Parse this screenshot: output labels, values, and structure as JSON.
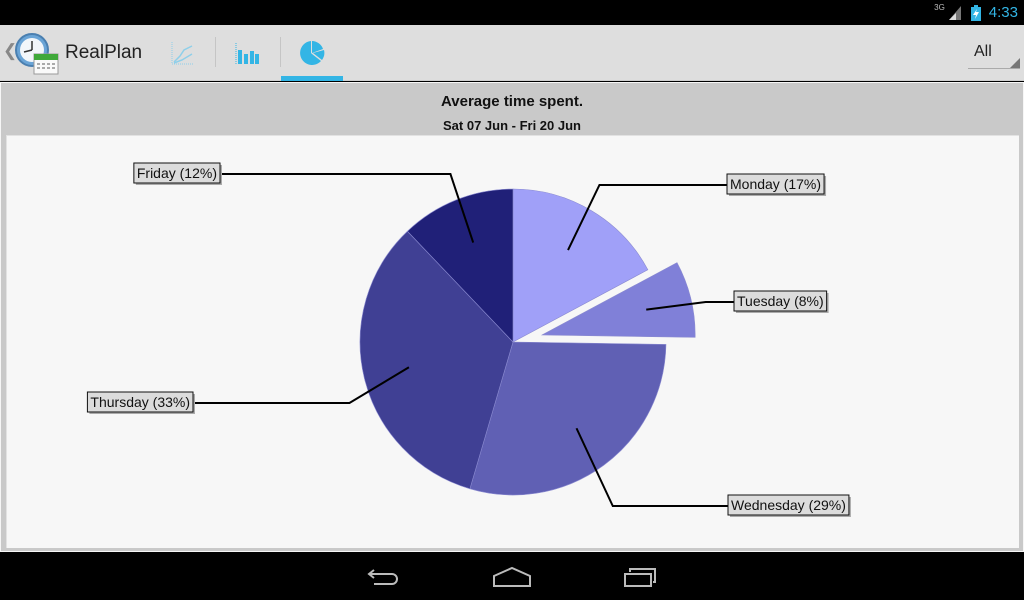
{
  "status_bar": {
    "network_label": "3G",
    "time": "4:33",
    "icons": [
      "signal-icon",
      "battery-charging-icon"
    ]
  },
  "action_bar": {
    "app_title": "RealPlan",
    "tabs": [
      {
        "name": "line-chart",
        "icon": "line-chart-icon",
        "active": false
      },
      {
        "name": "bar-chart",
        "icon": "bar-chart-icon",
        "active": false
      },
      {
        "name": "pie-chart",
        "icon": "pie-chart-icon",
        "active": true
      }
    ],
    "filter": {
      "selected": "All"
    },
    "accent_color": "#33b5e5"
  },
  "chart": {
    "title": "Average time spent.",
    "subtitle": "Sat 07 Jun - Fri 20 Jun"
  },
  "chart_data": {
    "type": "pie",
    "title": "Average time spent.",
    "subtitle": "Sat 07 Jun - Fri 20 Jun",
    "start_angle": "12 o'clock, clockwise",
    "slices": [
      {
        "label": "Monday",
        "value": 17,
        "display": "Monday (17%)",
        "color": "#a0a0f8",
        "exploded": false
      },
      {
        "label": "Tuesday",
        "value": 8,
        "display": "Tuesday (8%)",
        "color": "#8080d8",
        "exploded": true
      },
      {
        "label": "Wednesday",
        "value": 29,
        "display": "Wednesday (29%)",
        "color": "#6060b4",
        "exploded": false
      },
      {
        "label": "Thursday",
        "value": 33,
        "display": "Thursday (33%)",
        "color": "#404094",
        "exploded": false
      },
      {
        "label": "Friday",
        "value": 12,
        "display": "Friday (12%)",
        "color": "#202078",
        "exploded": false
      }
    ]
  },
  "nav_bar": {
    "buttons": [
      "back-icon",
      "home-icon",
      "recent-apps-icon"
    ]
  }
}
